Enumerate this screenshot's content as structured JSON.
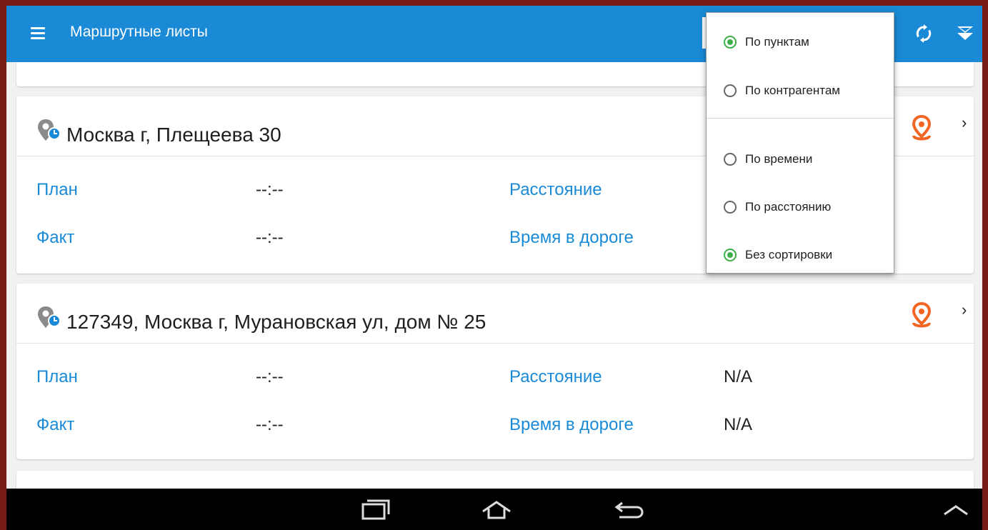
{
  "app": {
    "title": "Маршрутные листы",
    "bar_color": "#1a8ad6",
    "icons": [
      "menu-icon",
      "sync-icon",
      "filter-icon"
    ]
  },
  "sort_menu": {
    "options": [
      {
        "label": "По пунктам",
        "selected": true
      },
      {
        "label": "По контрагентам",
        "selected": false
      },
      {
        "label": "По времени",
        "selected": false
      },
      {
        "label": "По расстоянию",
        "selected": false
      },
      {
        "label": "Без сортировки",
        "selected": true
      }
    ]
  },
  "route_points": [
    {
      "address": "Москва г, Плещеева 30",
      "plan_label": "План",
      "plan_value": "--:--",
      "fact_label": "Факт",
      "fact_value": "--:--",
      "distance_label": "Расстояние",
      "travel_label": "Время в дороге"
    },
    {
      "address": "127349, Москва г, Мурановская ул, дом № 25",
      "plan_label": "План",
      "plan_value": "--:--",
      "fact_label": "Факт",
      "fact_value": "--:--",
      "distance_label": "Расстояние",
      "distance_value": "N/A",
      "travel_label": "Время в дороге",
      "travel_value": "N/A"
    }
  ],
  "colors": {
    "accent": "#1a8ad6",
    "map_icon": "#f26522",
    "radio_selected": "#3bb04a"
  },
  "navbar": {
    "icons": [
      "recent-apps-icon",
      "home-icon",
      "back-icon",
      "expand-up-icon"
    ]
  }
}
